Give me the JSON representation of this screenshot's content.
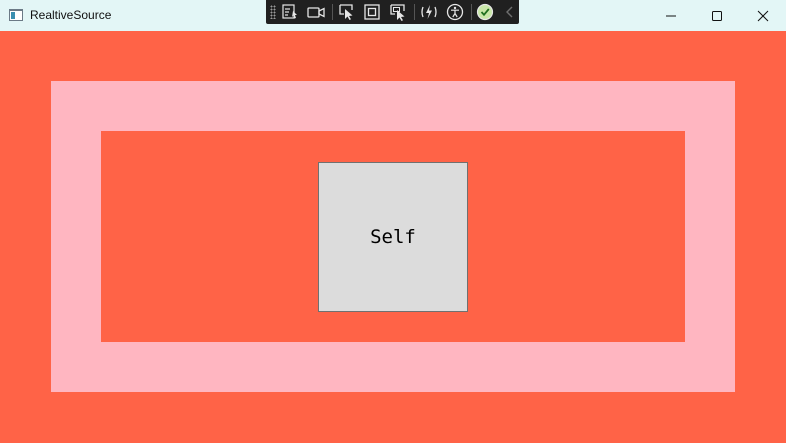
{
  "window": {
    "title": "RealtiveSource",
    "icon": "app-window-icon"
  },
  "titlebar_buttons": [
    {
      "name": "minimize",
      "icon": "minimize-icon"
    },
    {
      "name": "maximize",
      "icon": "maximize-icon"
    },
    {
      "name": "close",
      "icon": "close-icon"
    }
  ],
  "debug_toolbar": {
    "items": [
      "grip-icon",
      "live-visual-tree-icon",
      "record-camera-icon",
      "select-element-icon",
      "display-layout-adorners-icon",
      "track-focused-element-icon",
      "hot-reload-icon",
      "accessibility-icon",
      "binding-check-icon",
      "collapse-chevron-icon"
    ]
  },
  "content": {
    "self_button_label": "Self"
  },
  "colors": {
    "outer_background": "#ff6347",
    "pink_frame": "#ffb6c1",
    "inner_background": "#ff6347",
    "self_box": "#dcdcdc",
    "titlebar": "#e3f6f6",
    "toolbar": "#202020"
  }
}
